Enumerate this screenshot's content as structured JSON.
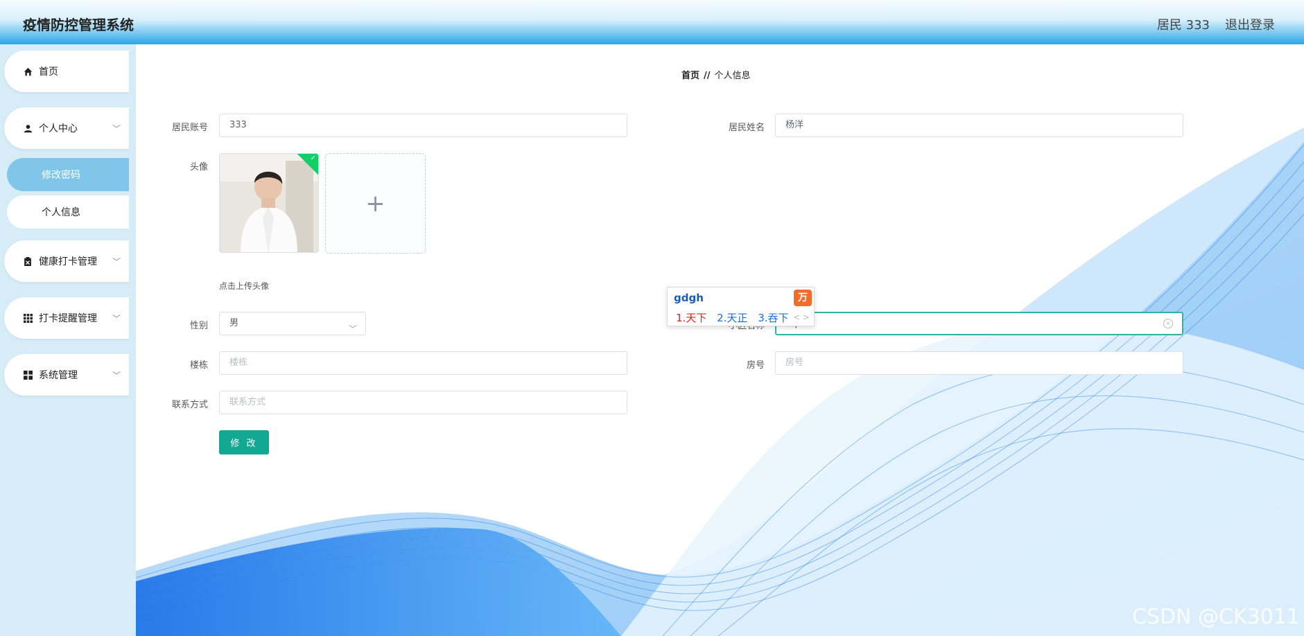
{
  "app": {
    "title": "疫情防控管理系统",
    "user": "居民 333",
    "logout": "退出登录"
  },
  "sidebar": {
    "items": [
      {
        "label": "首页",
        "icon": "home-icon"
      },
      {
        "label": "个人中心",
        "icon": "user-icon",
        "expanded": true,
        "children": [
          {
            "label": "修改密码",
            "active": true
          },
          {
            "label": "个人信息",
            "active": false
          }
        ]
      },
      {
        "label": "健康打卡管理",
        "icon": "clipboard-icon"
      },
      {
        "label": "打卡提醒管理",
        "icon": "grid-icon"
      },
      {
        "label": "系统管理",
        "icon": "apps-icon"
      }
    ]
  },
  "breadcrumb": {
    "home": "首页",
    "sep": "//",
    "current": "个人信息"
  },
  "form": {
    "account_label": "居民账号",
    "account_value": "333",
    "name_label": "居民姓名",
    "name_value": "杨洋",
    "avatar_label": "头像",
    "upload_plus": "+",
    "upload_hint": "点击上传头像",
    "gender_label": "性别",
    "gender_value": "男",
    "community_label": "小区名称",
    "community_value": "客",
    "building_label": "楼栋",
    "building_placeholder": "楼栋",
    "room_label": "房号",
    "room_placeholder": "房号",
    "contact_label": "联系方式",
    "contact_placeholder": "联系方式",
    "submit_label": "修 改"
  },
  "ime": {
    "composition": "gdgh",
    "logo": "万",
    "candidates": [
      "1.天下",
      "2.天正",
      "3.吞下"
    ],
    "arrows": "< >"
  },
  "watermark": "CSDN @CK3011",
  "colors": {
    "accent": "#12a892",
    "sidebar_bg": "#d6ecf7",
    "active_sub": "#7fc6ea",
    "header_blue": "#2aa7e8"
  }
}
